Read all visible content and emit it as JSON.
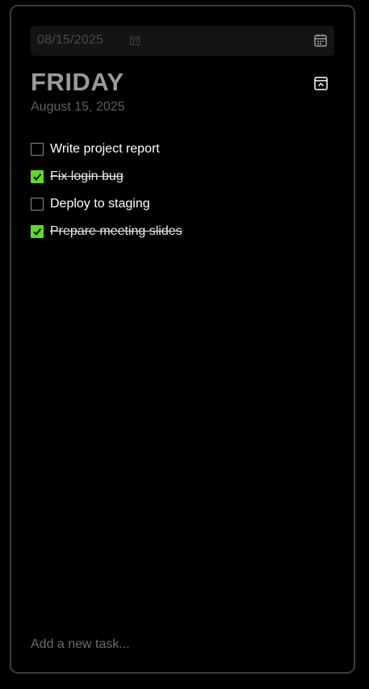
{
  "date_picker": {
    "value": "08/15/2025",
    "inline_icon": "calendar-icon",
    "button_icon": "calendar-icon"
  },
  "header": {
    "day": "FRIDAY",
    "full_date": "August 15, 2025",
    "collapse_icon": "collapse-icon"
  },
  "tasks": [
    {
      "label": "Write project report",
      "done": false
    },
    {
      "label": "Fix login bug",
      "done": true
    },
    {
      "label": "Deploy to staging",
      "done": false
    },
    {
      "label": "Prepare meeting slides",
      "done": true
    }
  ],
  "new_task": {
    "placeholder": "Add a new task...",
    "value": ""
  },
  "colors": {
    "background": "#000000",
    "border": "#3c3c3c",
    "check_accent": "#5dde1a",
    "title": "#9a9a9a"
  }
}
